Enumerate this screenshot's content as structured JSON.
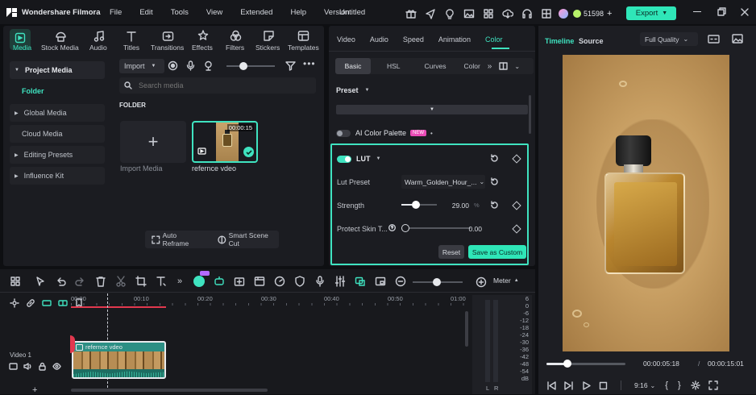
{
  "app": {
    "name": "Wondershare Filmora",
    "title": "Untitled",
    "menu": [
      "File",
      "Edit",
      "Tools",
      "View",
      "Extended",
      "Help",
      "Version"
    ],
    "credits": "51598",
    "export_label": "Export"
  },
  "media_tabs": [
    "Media",
    "Stock Media",
    "Audio",
    "Titles",
    "Transitions",
    "Effects",
    "Filters",
    "Stickers",
    "Templates"
  ],
  "sidebar": {
    "items": [
      {
        "label": "Project Media"
      },
      {
        "label": "Folder"
      },
      {
        "label": "Global Media"
      },
      {
        "label": "Cloud Media"
      },
      {
        "label": "Editing Presets"
      },
      {
        "label": "Influence Kit"
      }
    ]
  },
  "media_panel": {
    "import_label": "Import",
    "search_placeholder": "Search media",
    "folder_label": "FOLDER",
    "import_media_label": "Import Media",
    "clip_name": "refernce vdeo",
    "clip_duration": "00:00:15",
    "auto_reframe": "Auto Reframe",
    "smart_scene_cut": "Smart Scene Cut"
  },
  "properties": {
    "tabs": [
      "Video",
      "Audio",
      "Speed",
      "Animation",
      "Color"
    ],
    "subtabs": [
      "Basic",
      "HSL",
      "Curves",
      "Color"
    ],
    "preset_label": "Preset",
    "ai_palette_label": "AI Color Palette",
    "new_badge": "NEW",
    "lut": {
      "title": "LUT",
      "preset_label": "Lut Preset",
      "preset_value": "Warm_Golden_Hour_...",
      "strength_label": "Strength",
      "strength_value": "29.00",
      "strength_unit": "%",
      "strength_fraction": 0.29,
      "protect_label": "Protect Skin T...",
      "protect_value": "0.00",
      "protect_fraction": 0.0,
      "reset_label": "Reset",
      "save_label": "Save as Custom"
    }
  },
  "player": {
    "tabs": [
      "Timeline",
      "Source"
    ],
    "quality": "Full Quality",
    "current_time": "00:00:05:18",
    "separator": "/",
    "total_time": "00:00:15:01",
    "aspect": "9:16",
    "progress_fraction": 0.27
  },
  "timeline": {
    "meter_label": "Meter",
    "ruler": [
      "00:00",
      "00:10",
      "00:20",
      "00:30",
      "00:40",
      "00:50",
      "01:00"
    ],
    "track_label": "Video 1",
    "clip_label": "refernce vdeo",
    "meter_scale": [
      "6",
      "0",
      "-6",
      "-12",
      "-18",
      "-24",
      "-30",
      "-36",
      "-42",
      "-48",
      "-54",
      "dB"
    ],
    "meter_channels": [
      "L",
      "R"
    ]
  },
  "colors": {
    "accent": "#3fe3c0",
    "export": "#2fe6b8",
    "clip": "#2c8f84"
  }
}
